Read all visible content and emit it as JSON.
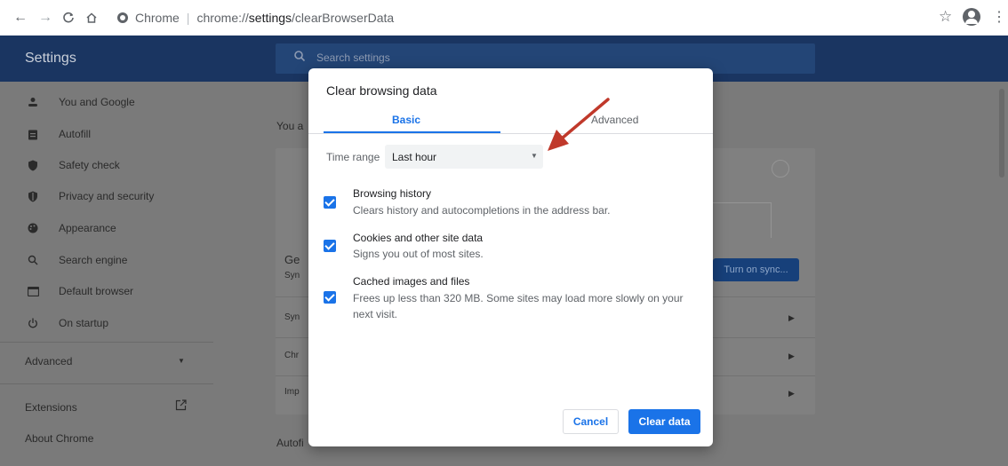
{
  "browser": {
    "chip_label": "Chrome",
    "url_prefix": "chrome://",
    "url_host": "settings",
    "url_path": "/clearBrowserData"
  },
  "header": {
    "title": "Settings",
    "search_placeholder": "Search settings"
  },
  "sidebar": {
    "items": [
      {
        "label": "You and Google",
        "icon": "person-icon"
      },
      {
        "label": "Autofill",
        "icon": "clipboard-icon"
      },
      {
        "label": "Safety check",
        "icon": "shield-check-icon"
      },
      {
        "label": "Privacy and security",
        "icon": "shield-icon"
      },
      {
        "label": "Appearance",
        "icon": "palette-icon"
      },
      {
        "label": "Search engine",
        "icon": "search-icon"
      },
      {
        "label": "Default browser",
        "icon": "browser-icon"
      },
      {
        "label": "On startup",
        "icon": "power-icon"
      }
    ],
    "advanced": "Advanced",
    "extensions": "Extensions",
    "about": "About Chrome"
  },
  "main": {
    "you_a": "You a",
    "ge": "Ge",
    "syn1": "Syn",
    "syn2": "Syn",
    "chr": "Chr",
    "imp": "Imp",
    "autofi": "Autofi",
    "sync_button": "Turn on sync..."
  },
  "dialog": {
    "title": "Clear browsing data",
    "tabs": [
      "Basic",
      "Advanced"
    ],
    "time_range_label": "Time range",
    "time_range_value": "Last hour",
    "options": [
      {
        "title": "Browsing history",
        "desc": "Clears history and autocompletions in the address bar.",
        "checked": true
      },
      {
        "title": "Cookies and other site data",
        "desc": "Signs you out of most sites.",
        "checked": true
      },
      {
        "title": "Cached images and files",
        "desc": "Frees up less than 320 MB. Some sites may load more slowly on your next visit.",
        "checked": true
      }
    ],
    "cancel": "Cancel",
    "clear": "Clear data"
  },
  "colors": {
    "accent": "#1a73e8",
    "header_bg": "#1a3561",
    "annotation_arrow": "#c0392b"
  }
}
